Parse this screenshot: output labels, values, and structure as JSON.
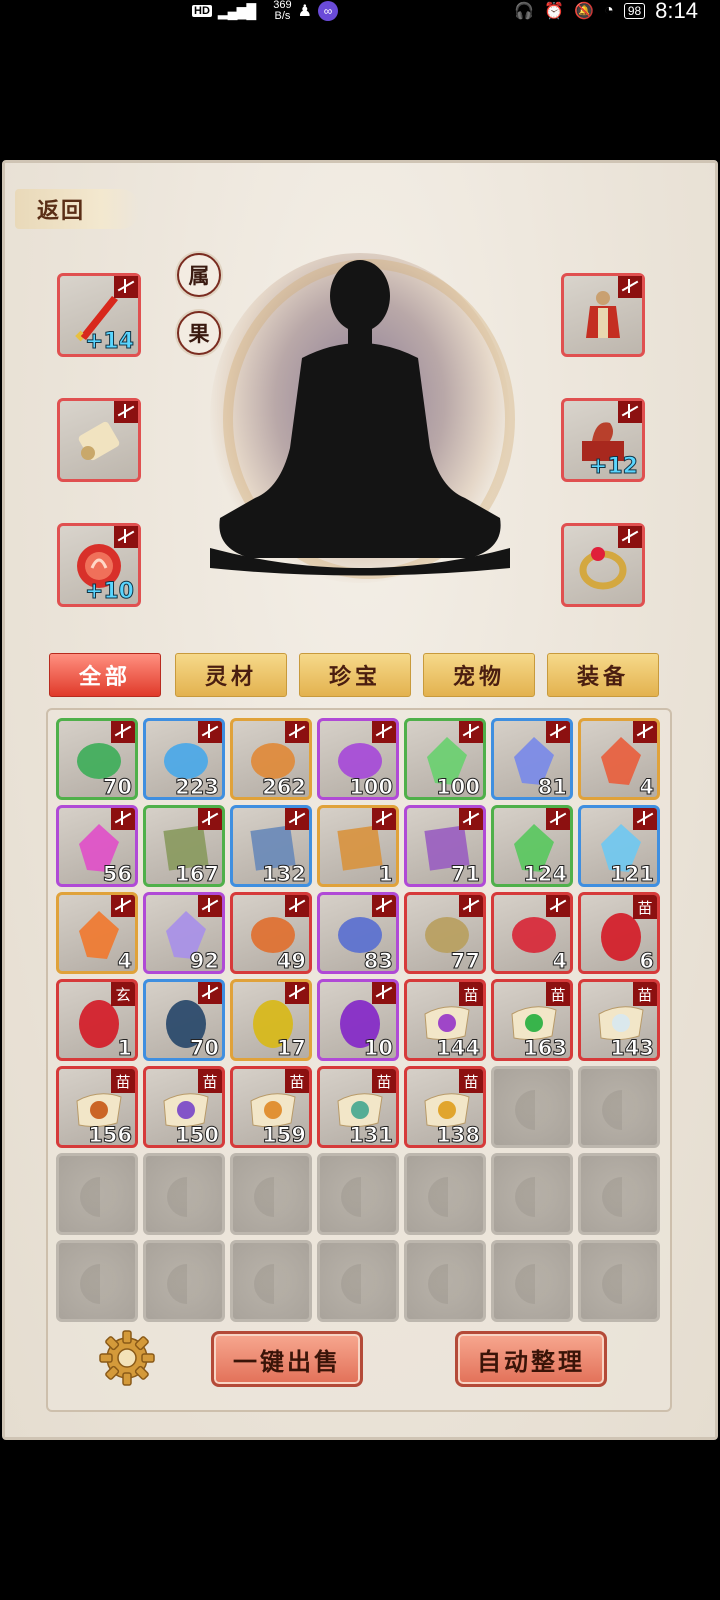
{
  "status_bar": {
    "hd": "HD",
    "signal": "4G",
    "speed_top": "369",
    "speed_bottom": "B/s",
    "battery": "98",
    "time": "8:14"
  },
  "header": {
    "back_label": "返回"
  },
  "attributes": {
    "shu_label": "属",
    "guo_label": "果"
  },
  "equipment": {
    "left": [
      {
        "name": "weapon-sword",
        "count": "+14"
      },
      {
        "name": "scroll",
        "count": ""
      },
      {
        "name": "amulet",
        "count": "+10"
      }
    ],
    "right": [
      {
        "name": "armor",
        "count": ""
      },
      {
        "name": "treasure-box",
        "count": "+12"
      },
      {
        "name": "ring",
        "count": ""
      }
    ]
  },
  "tabs": [
    {
      "label": "全部",
      "active": true
    },
    {
      "label": "灵材",
      "active": false
    },
    {
      "label": "珍宝",
      "active": false
    },
    {
      "label": "宠物",
      "active": false
    },
    {
      "label": "装备",
      "active": false
    }
  ],
  "inventory": [
    [
      {
        "q": "g",
        "icon": "coral",
        "count": "70",
        "tag": "lock"
      },
      {
        "q": "b",
        "icon": "blue-flower",
        "count": "223",
        "tag": "lock"
      },
      {
        "q": "o",
        "icon": "ginseng",
        "count": "262",
        "tag": "lock"
      },
      {
        "q": "p",
        "icon": "purple-mushroom",
        "count": "100",
        "tag": "lock"
      },
      {
        "q": "g",
        "icon": "green-crystal",
        "count": "100",
        "tag": "lock"
      },
      {
        "q": "b",
        "icon": "blue-crystal",
        "count": "81",
        "tag": "lock"
      },
      {
        "q": "o",
        "icon": "red-crystal",
        "count": "4",
        "tag": "lock"
      }
    ],
    [
      {
        "q": "p",
        "icon": "pink-gem",
        "count": "56",
        "tag": "lock"
      },
      {
        "q": "g",
        "icon": "green-cloth",
        "count": "167",
        "tag": "lock"
      },
      {
        "q": "b",
        "icon": "blue-cloth",
        "count": "132",
        "tag": "lock"
      },
      {
        "q": "o",
        "icon": "orange-cloth",
        "count": "1",
        "tag": "lock"
      },
      {
        "q": "p",
        "icon": "purple-cloth",
        "count": "71",
        "tag": "lock"
      },
      {
        "q": "g",
        "icon": "green-leaf-gem",
        "count": "124",
        "tag": "lock"
      },
      {
        "q": "b",
        "icon": "ice-crystal",
        "count": "121",
        "tag": "lock"
      }
    ],
    [
      {
        "q": "o",
        "icon": "flame-crystal",
        "count": "4",
        "tag": "lock"
      },
      {
        "q": "p",
        "icon": "star-crystal",
        "count": "92",
        "tag": "lock"
      },
      {
        "q": "r",
        "icon": "fire-branch",
        "count": "49",
        "tag": "lock"
      },
      {
        "q": "p",
        "icon": "blue-stone",
        "count": "83",
        "tag": "lock"
      },
      {
        "q": "r",
        "icon": "jade-disc",
        "count": "77",
        "tag": "lock"
      },
      {
        "q": "r",
        "icon": "red-key",
        "count": "4",
        "tag": "lock"
      },
      {
        "q": "r",
        "icon": "red-egg",
        "count": "6",
        "tag": "苗"
      }
    ],
    [
      {
        "q": "r",
        "icon": "red-egg",
        "count": "1",
        "tag": "玄"
      },
      {
        "q": "b",
        "icon": "blue-egg",
        "count": "70",
        "tag": "lock"
      },
      {
        "q": "o",
        "icon": "gold-egg",
        "count": "17",
        "tag": "lock"
      },
      {
        "q": "p",
        "icon": "purple-egg",
        "count": "10",
        "tag": "lock"
      },
      {
        "q": "r",
        "icon": "purple-pearl-scroll",
        "count": "144",
        "tag": "苗"
      },
      {
        "q": "r",
        "icon": "green-pearl-scroll",
        "count": "163",
        "tag": "苗"
      },
      {
        "q": "r",
        "icon": "white-pearl-scroll",
        "count": "143",
        "tag": "苗"
      }
    ],
    [
      {
        "q": "r",
        "icon": "orange-pearl-scroll",
        "count": "156",
        "tag": "苗"
      },
      {
        "q": "r",
        "icon": "violet-pearl-scroll",
        "count": "150",
        "tag": "苗"
      },
      {
        "q": "r",
        "icon": "amber-pearl-scroll",
        "count": "159",
        "tag": "苗"
      },
      {
        "q": "r",
        "icon": "teal-pearl-scroll",
        "count": "131",
        "tag": "苗"
      },
      {
        "q": "r",
        "icon": "gold-pearl-scroll",
        "count": "138",
        "tag": "苗"
      },
      null,
      null
    ],
    [
      null,
      null,
      null,
      null,
      null,
      null,
      null
    ],
    [
      null,
      null,
      null,
      null,
      null,
      null,
      null
    ]
  ],
  "footer": {
    "sell_label": "一键出售",
    "sort_label": "自动整理"
  },
  "colors": {
    "quality_green": "#4fb04a",
    "quality_blue": "#3f8fe0",
    "quality_purple": "#b04ad6",
    "quality_orange": "#e0a23a",
    "quality_red": "#d63a3a",
    "tab_active": "#e03a2a",
    "tab_normal": "#e3b24f"
  }
}
